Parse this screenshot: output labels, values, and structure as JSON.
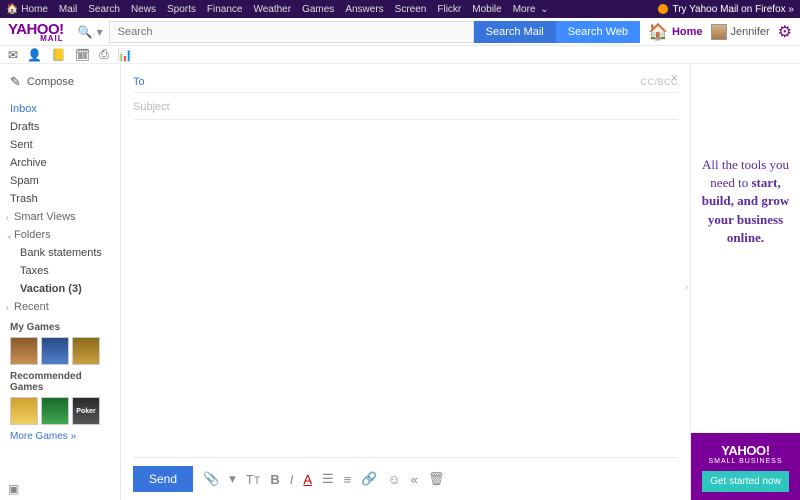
{
  "topnav": {
    "items": [
      "Home",
      "Mail",
      "Search",
      "News",
      "Sports",
      "Finance",
      "Weather",
      "Games",
      "Answers",
      "Screen",
      "Flickr",
      "Mobile",
      "More"
    ],
    "more_chevron": "⌄",
    "try_label": "Try Yahoo Mail on Firefox »"
  },
  "header": {
    "logo_main": "YAHOO!",
    "logo_sub": "MAIL",
    "search_placeholder": "Search",
    "search_mail_btn": "Search Mail",
    "search_web_btn": "Search Web",
    "home_label": "Home",
    "user_name": "Jennifer"
  },
  "iconrow": [
    "✉",
    "👤",
    "📒",
    "🗓",
    "⎙",
    "📊"
  ],
  "sidebar": {
    "compose_label": "Compose",
    "folders_primary": [
      "Inbox",
      "Drafts",
      "Sent",
      "Archive",
      "Spam",
      "Trash"
    ],
    "active_folder": "Inbox",
    "sections": [
      {
        "label": "Smart Views",
        "chevron": "›"
      },
      {
        "label": "Folders",
        "chevron": "⌄",
        "children": [
          "Bank statements",
          "Taxes",
          "Vacation (3)"
        ],
        "bold_child": "Vacation (3)"
      },
      {
        "label": "Recent",
        "chevron": "›"
      }
    ],
    "my_games_label": "My Games",
    "rec_games_label": "Recommended Games",
    "more_games_label": "More Games »"
  },
  "compose": {
    "to_label": "To",
    "ccbcc_label": "CC/BCC",
    "subject_placeholder": "Subject",
    "send_label": "Send",
    "close_icon": "×"
  },
  "ad": {
    "line1": "All the tools you need to ",
    "bold": "start, build, and grow your business online.",
    "logo": "YAHOO!",
    "logo_sub": "SMALL BUSINESS",
    "cta": "Get started now"
  },
  "icons": {
    "home": "🏠",
    "gear": "⚙",
    "search": "🔍",
    "dropdown": "▾",
    "pencil": "✎",
    "collapse": "›"
  }
}
